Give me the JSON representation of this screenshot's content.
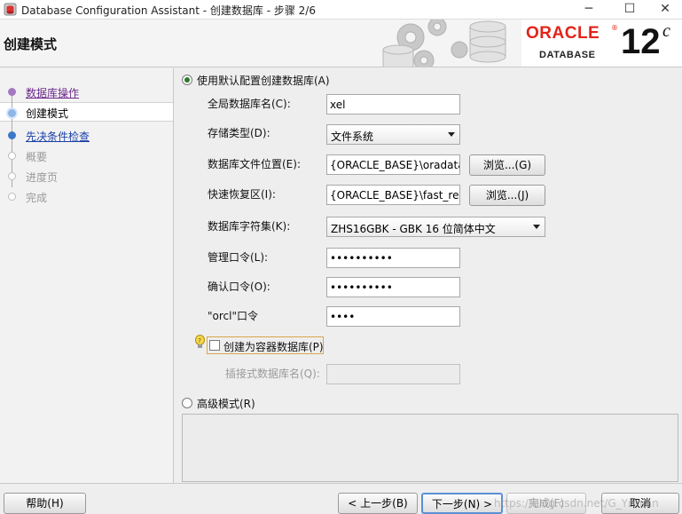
{
  "window": {
    "title": "Database Configuration Assistant - 创建数据库 - 步骤 2/6",
    "minimize_glyph": "─",
    "maximize_glyph": "☐",
    "close_glyph": "✕"
  },
  "header": {
    "heading": "创建模式",
    "oracle_brand": "ORACLE",
    "registered": "®",
    "database_label": "DATABASE",
    "version": "12",
    "version_suffix": "c",
    "brand_color": "#e2231a"
  },
  "nav": {
    "items": [
      {
        "label": "数据库操作",
        "state": "visited"
      },
      {
        "label": "创建模式",
        "state": "current"
      },
      {
        "label": "先决条件检查",
        "state": "link"
      },
      {
        "label": "概要",
        "state": "disabled"
      },
      {
        "label": "进度页",
        "state": "disabled"
      },
      {
        "label": "完成",
        "state": "disabled"
      }
    ]
  },
  "form": {
    "default_config_option": {
      "label": "使用默认配置创建数据库(A)",
      "selected": true
    },
    "global_db_name": {
      "label": "全局数据库名(C):",
      "value": "xel"
    },
    "storage_type": {
      "label": "存储类型(D):",
      "value": "文件系统"
    },
    "db_file_location": {
      "label": "数据库文件位置(E):",
      "value": "{ORACLE_BASE}\\oradata",
      "browse_label": "浏览...(G)"
    },
    "fast_recovery_area": {
      "label": "快速恢复区(I):",
      "value": "{ORACLE_BASE}\\fast_recov",
      "browse_label": "浏览...(J)"
    },
    "charset": {
      "label": "数据库字符集(K):",
      "value": "ZHS16GBK - GBK 16 位简体中文"
    },
    "admin_password": {
      "label": "管理口令(L):",
      "value": "••••••••••"
    },
    "confirm_password": {
      "label": "确认口令(O):",
      "value": "••••••••••"
    },
    "orcl_password": {
      "label": "\"orcl\"口令",
      "value": "••••"
    },
    "container_db": {
      "label": "创建为容器数据库(P)",
      "checked": false
    },
    "pluggable_db_name": {
      "label": "插接式数据库名(Q):",
      "value": ""
    },
    "advanced_option": {
      "label": "高级模式(R)",
      "selected": false
    }
  },
  "footer": {
    "help": "帮助(H)",
    "back": "< 上一步(B)",
    "next": "下一步(N) >",
    "finish": "完成(F)",
    "cancel": "取消"
  },
  "watermark": "https://blog.csdn.net/G_Yrmian"
}
